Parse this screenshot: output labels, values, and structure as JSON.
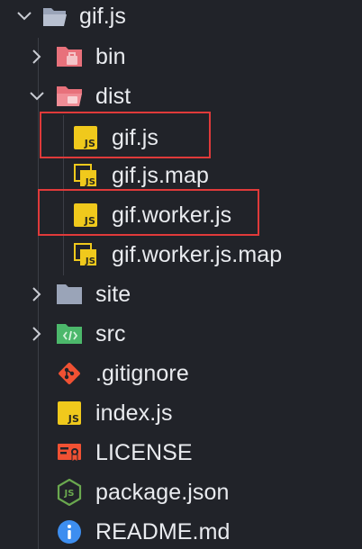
{
  "tree": {
    "root": {
      "label": "gif.js",
      "expanded": true
    },
    "items": [
      {
        "label": "bin",
        "type": "folder",
        "icon": "bin-folder-icon",
        "expanded": false,
        "level": 1
      },
      {
        "label": "dist",
        "type": "folder",
        "icon": "dist-folder-icon",
        "expanded": true,
        "level": 1
      },
      {
        "label": "gif.js",
        "type": "file",
        "icon": "js-file-icon",
        "level": 2,
        "highlighted": true
      },
      {
        "label": "gif.js.map",
        "type": "file",
        "icon": "js-map-file-icon",
        "level": 2,
        "highlighted": false
      },
      {
        "label": "gif.worker.js",
        "type": "file",
        "icon": "js-file-icon",
        "level": 2,
        "highlighted": true
      },
      {
        "label": "gif.worker.js.map",
        "type": "file",
        "icon": "js-map-file-icon",
        "level": 2,
        "highlighted": false
      },
      {
        "label": "site",
        "type": "folder",
        "icon": "folder-icon",
        "expanded": false,
        "level": 1
      },
      {
        "label": "src",
        "type": "folder",
        "icon": "src-folder-icon",
        "expanded": false,
        "level": 1
      },
      {
        "label": ".gitignore",
        "type": "file",
        "icon": "git-icon",
        "level": 1
      },
      {
        "label": "index.js",
        "type": "file",
        "icon": "js-file-icon",
        "level": 1
      },
      {
        "label": "LICENSE",
        "type": "file",
        "icon": "license-icon",
        "level": 1
      },
      {
        "label": "package.json",
        "type": "file",
        "icon": "nodejs-icon",
        "level": 1
      },
      {
        "label": "README.md",
        "type": "file",
        "icon": "info-icon",
        "level": 1
      }
    ]
  },
  "colors": {
    "background": "#212329",
    "text": "#e9ebef",
    "js_yellow": "#f0c91c",
    "highlight_border": "#e03a3a",
    "bin_folder": "#e8717b",
    "src_folder": "#4cb86b",
    "plain_folder": "#9aa4b8",
    "git_orange": "#f05133",
    "info_blue": "#3d8ef0",
    "nodejs_green": "#6aa84f"
  }
}
